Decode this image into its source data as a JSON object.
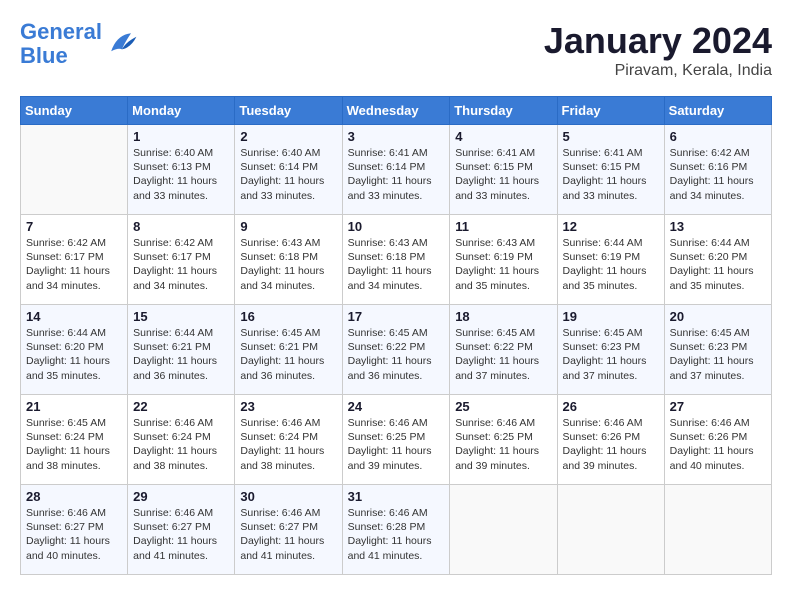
{
  "logo": {
    "text_general": "General",
    "text_blue": "Blue"
  },
  "title": "January 2024",
  "subtitle": "Piravam, Kerala, India",
  "weekdays": [
    "Sunday",
    "Monday",
    "Tuesday",
    "Wednesday",
    "Thursday",
    "Friday",
    "Saturday"
  ],
  "weeks": [
    [
      {
        "day": "",
        "sunrise": "",
        "sunset": "",
        "daylight": ""
      },
      {
        "day": "1",
        "sunrise": "Sunrise: 6:40 AM",
        "sunset": "Sunset: 6:13 PM",
        "daylight": "Daylight: 11 hours and 33 minutes."
      },
      {
        "day": "2",
        "sunrise": "Sunrise: 6:40 AM",
        "sunset": "Sunset: 6:14 PM",
        "daylight": "Daylight: 11 hours and 33 minutes."
      },
      {
        "day": "3",
        "sunrise": "Sunrise: 6:41 AM",
        "sunset": "Sunset: 6:14 PM",
        "daylight": "Daylight: 11 hours and 33 minutes."
      },
      {
        "day": "4",
        "sunrise": "Sunrise: 6:41 AM",
        "sunset": "Sunset: 6:15 PM",
        "daylight": "Daylight: 11 hours and 33 minutes."
      },
      {
        "day": "5",
        "sunrise": "Sunrise: 6:41 AM",
        "sunset": "Sunset: 6:15 PM",
        "daylight": "Daylight: 11 hours and 33 minutes."
      },
      {
        "day": "6",
        "sunrise": "Sunrise: 6:42 AM",
        "sunset": "Sunset: 6:16 PM",
        "daylight": "Daylight: 11 hours and 34 minutes."
      }
    ],
    [
      {
        "day": "7",
        "sunrise": "Sunrise: 6:42 AM",
        "sunset": "Sunset: 6:17 PM",
        "daylight": "Daylight: 11 hours and 34 minutes."
      },
      {
        "day": "8",
        "sunrise": "Sunrise: 6:42 AM",
        "sunset": "Sunset: 6:17 PM",
        "daylight": "Daylight: 11 hours and 34 minutes."
      },
      {
        "day": "9",
        "sunrise": "Sunrise: 6:43 AM",
        "sunset": "Sunset: 6:18 PM",
        "daylight": "Daylight: 11 hours and 34 minutes."
      },
      {
        "day": "10",
        "sunrise": "Sunrise: 6:43 AM",
        "sunset": "Sunset: 6:18 PM",
        "daylight": "Daylight: 11 hours and 34 minutes."
      },
      {
        "day": "11",
        "sunrise": "Sunrise: 6:43 AM",
        "sunset": "Sunset: 6:19 PM",
        "daylight": "Daylight: 11 hours and 35 minutes."
      },
      {
        "day": "12",
        "sunrise": "Sunrise: 6:44 AM",
        "sunset": "Sunset: 6:19 PM",
        "daylight": "Daylight: 11 hours and 35 minutes."
      },
      {
        "day": "13",
        "sunrise": "Sunrise: 6:44 AM",
        "sunset": "Sunset: 6:20 PM",
        "daylight": "Daylight: 11 hours and 35 minutes."
      }
    ],
    [
      {
        "day": "14",
        "sunrise": "Sunrise: 6:44 AM",
        "sunset": "Sunset: 6:20 PM",
        "daylight": "Daylight: 11 hours and 35 minutes."
      },
      {
        "day": "15",
        "sunrise": "Sunrise: 6:44 AM",
        "sunset": "Sunset: 6:21 PM",
        "daylight": "Daylight: 11 hours and 36 minutes."
      },
      {
        "day": "16",
        "sunrise": "Sunrise: 6:45 AM",
        "sunset": "Sunset: 6:21 PM",
        "daylight": "Daylight: 11 hours and 36 minutes."
      },
      {
        "day": "17",
        "sunrise": "Sunrise: 6:45 AM",
        "sunset": "Sunset: 6:22 PM",
        "daylight": "Daylight: 11 hours and 36 minutes."
      },
      {
        "day": "18",
        "sunrise": "Sunrise: 6:45 AM",
        "sunset": "Sunset: 6:22 PM",
        "daylight": "Daylight: 11 hours and 37 minutes."
      },
      {
        "day": "19",
        "sunrise": "Sunrise: 6:45 AM",
        "sunset": "Sunset: 6:23 PM",
        "daylight": "Daylight: 11 hours and 37 minutes."
      },
      {
        "day": "20",
        "sunrise": "Sunrise: 6:45 AM",
        "sunset": "Sunset: 6:23 PM",
        "daylight": "Daylight: 11 hours and 37 minutes."
      }
    ],
    [
      {
        "day": "21",
        "sunrise": "Sunrise: 6:45 AM",
        "sunset": "Sunset: 6:24 PM",
        "daylight": "Daylight: 11 hours and 38 minutes."
      },
      {
        "day": "22",
        "sunrise": "Sunrise: 6:46 AM",
        "sunset": "Sunset: 6:24 PM",
        "daylight": "Daylight: 11 hours and 38 minutes."
      },
      {
        "day": "23",
        "sunrise": "Sunrise: 6:46 AM",
        "sunset": "Sunset: 6:24 PM",
        "daylight": "Daylight: 11 hours and 38 minutes."
      },
      {
        "day": "24",
        "sunrise": "Sunrise: 6:46 AM",
        "sunset": "Sunset: 6:25 PM",
        "daylight": "Daylight: 11 hours and 39 minutes."
      },
      {
        "day": "25",
        "sunrise": "Sunrise: 6:46 AM",
        "sunset": "Sunset: 6:25 PM",
        "daylight": "Daylight: 11 hours and 39 minutes."
      },
      {
        "day": "26",
        "sunrise": "Sunrise: 6:46 AM",
        "sunset": "Sunset: 6:26 PM",
        "daylight": "Daylight: 11 hours and 39 minutes."
      },
      {
        "day": "27",
        "sunrise": "Sunrise: 6:46 AM",
        "sunset": "Sunset: 6:26 PM",
        "daylight": "Daylight: 11 hours and 40 minutes."
      }
    ],
    [
      {
        "day": "28",
        "sunrise": "Sunrise: 6:46 AM",
        "sunset": "Sunset: 6:27 PM",
        "daylight": "Daylight: 11 hours and 40 minutes."
      },
      {
        "day": "29",
        "sunrise": "Sunrise: 6:46 AM",
        "sunset": "Sunset: 6:27 PM",
        "daylight": "Daylight: 11 hours and 41 minutes."
      },
      {
        "day": "30",
        "sunrise": "Sunrise: 6:46 AM",
        "sunset": "Sunset: 6:27 PM",
        "daylight": "Daylight: 11 hours and 41 minutes."
      },
      {
        "day": "31",
        "sunrise": "Sunrise: 6:46 AM",
        "sunset": "Sunset: 6:28 PM",
        "daylight": "Daylight: 11 hours and 41 minutes."
      },
      {
        "day": "",
        "sunrise": "",
        "sunset": "",
        "daylight": ""
      },
      {
        "day": "",
        "sunrise": "",
        "sunset": "",
        "daylight": ""
      },
      {
        "day": "",
        "sunrise": "",
        "sunset": "",
        "daylight": ""
      }
    ]
  ]
}
